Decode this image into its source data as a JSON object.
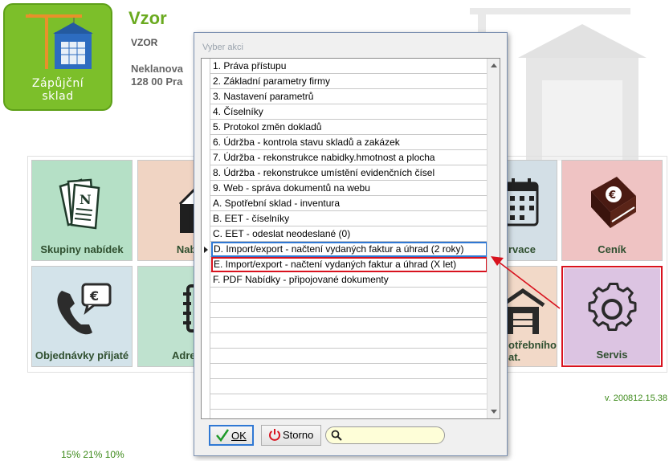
{
  "app": {
    "logo_text_line1": "Zápůjční",
    "logo_text_line2": "sklad",
    "title": "Vzor",
    "company": "VZOR",
    "address_line1": "Neklanova",
    "address_line2": "128 00 Pra",
    "version": "v. 200812.15.38",
    "stats": "15% 21% 10%"
  },
  "tiles": [
    {
      "label": "Skupiny nabídek",
      "color": "#b5e0c6",
      "icon": "documents-icon"
    },
    {
      "label": "Nabí",
      "color": "#f0d4c3",
      "icon": "envelope-icon"
    },
    {
      "label": "rvace",
      "color": "#d3dfe6",
      "icon": "calendar-icon"
    },
    {
      "label": "Ceník",
      "color": "#efc3c3",
      "icon": "book-euro-icon"
    },
    {
      "label": "Objednávky přijaté",
      "color": "#d3e3ea",
      "icon": "phone-euro-icon"
    },
    {
      "label": "Adre",
      "color": "#bfe2cf",
      "icon": "address-book-icon"
    },
    {
      "label": "otřebního",
      "label2": "at.",
      "color": "#f2d9c8",
      "icon": "warehouse-icon"
    },
    {
      "label": "Servis",
      "color": "#dcc4e2",
      "icon": "gear-icon"
    }
  ],
  "dialog": {
    "title": "Vyber akci",
    "rows": [
      "1. Práva přístupu",
      "2. Základní parametry firmy",
      "3. Nastavení parametrů",
      "4. Číselníky",
      "5. Protokol změn dokladů",
      "6. Údržba - kontrola stavu skladů a zakázek",
      "7. Údržba - rekonstrukce nabidky.hmotnost a plocha",
      "8. Údržba - rekonstrukce umístění evidenčních čísel",
      "9. Web - správa dokumentů na webu",
      "A. Spotřební sklad - inventura",
      "B. EET - číselníky",
      "C. EET - odeslat neodeslané (0)",
      "D. Import/export  - načtení vydaných faktur a úhrad (2 roky)",
      "E. Import/export  - načtení vydaných faktur a úhrad (X let)",
      "F. PDF Nabídky - připojované dokumenty"
    ],
    "selected_index": 12,
    "highlighted_index": 13,
    "ok_label": "OK",
    "storno_label": "Storno",
    "search_value": ""
  },
  "colors": {
    "accent": "#7cbf2a",
    "selection": "#2f78d4",
    "annotation": "#d8121e"
  }
}
